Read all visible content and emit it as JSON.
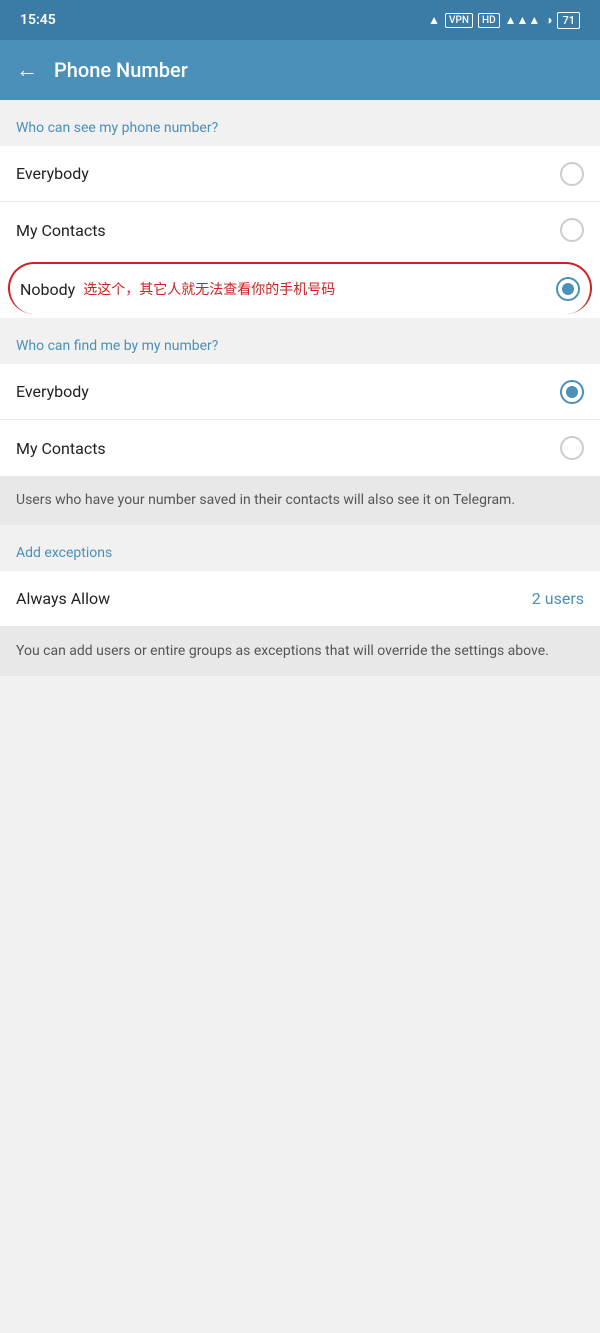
{
  "statusBar": {
    "time": "15:45",
    "icons": "🔵 VPN HD ▲▲▲ ▼▼ 71"
  },
  "header": {
    "backLabel": "←",
    "title": "Phone Number"
  },
  "section1": {
    "label": "Who can see my phone number?",
    "options": [
      {
        "id": "everybody1",
        "label": "Everybody",
        "selected": false
      },
      {
        "id": "mycontacts1",
        "label": "My Contacts",
        "selected": false
      },
      {
        "id": "nobody",
        "label": "Nobody",
        "selected": true,
        "annotation": "选这个，其它人就无法查看你的手机号码"
      }
    ]
  },
  "section2": {
    "label": "Who can find me by my number?",
    "options": [
      {
        "id": "everybody2",
        "label": "Everybody",
        "selected": true
      },
      {
        "id": "mycontacts2",
        "label": "My Contacts",
        "selected": false
      }
    ]
  },
  "infoBox": {
    "text": "Users who have your number saved in their contacts will also see it on Telegram."
  },
  "exceptions": {
    "label": "Add exceptions",
    "alwaysAllow": {
      "label": "Always Allow",
      "count": "2 users"
    },
    "info": "You can add users or entire groups as exceptions that will override the settings above."
  }
}
